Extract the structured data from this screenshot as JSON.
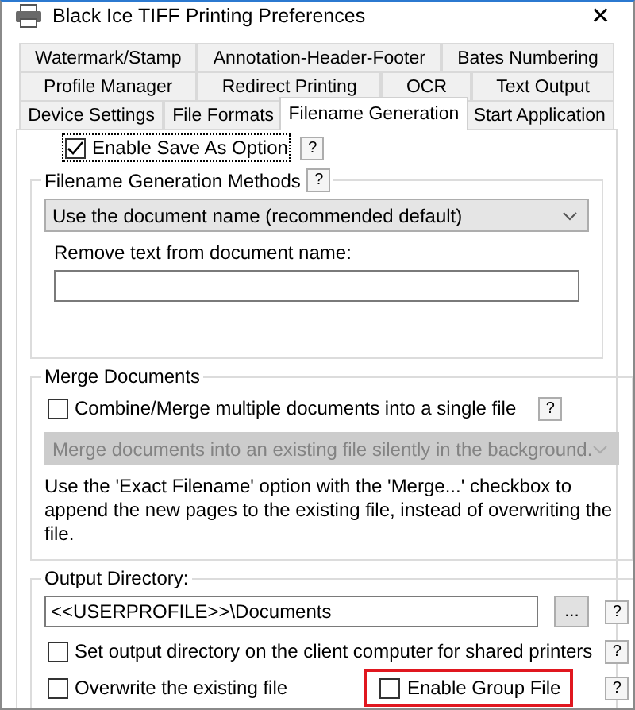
{
  "window": {
    "title": "Black Ice TIFF Printing Preferences",
    "close": "✕"
  },
  "tab_rows": [
    [
      {
        "label": "Watermark/Stamp",
        "selected": false
      },
      {
        "label": "Annotation-Header-Footer",
        "selected": false
      },
      {
        "label": "Bates Numbering",
        "selected": false
      }
    ],
    [
      {
        "label": "Profile Manager",
        "selected": false
      },
      {
        "label": "Redirect Printing",
        "selected": false
      },
      {
        "label": "OCR",
        "selected": false
      },
      {
        "label": "Text Output",
        "selected": false
      }
    ],
    [
      {
        "label": "Device Settings",
        "selected": false
      },
      {
        "label": "File Formats",
        "selected": false
      },
      {
        "label": "Filename Generation",
        "selected": true
      },
      {
        "label": "Start Application",
        "selected": false
      }
    ]
  ],
  "save_as": {
    "label": "Enable Save As Option",
    "checked": true,
    "help": "?"
  },
  "filename_methods": {
    "title": "Filename Generation Methods",
    "help": "?",
    "method": "Use the document name (recommended default)",
    "remove_label": "Remove text from document name:"
  },
  "merge": {
    "title": "Merge Documents",
    "checkbox": {
      "label": "Combine/Merge multiple documents into a single file",
      "checked": false
    },
    "help": "?",
    "mode": {
      "value": "Merge documents into an existing file silently in the background.",
      "disabled": true
    },
    "note": "Use the 'Exact Filename' option with the 'Merge...' checkbox to append the new pages to the existing file, instead of overwriting the file."
  },
  "output": {
    "title": "Output Directory:",
    "path": "<<USERPROFILE>>\\Documents",
    "browse": "...",
    "help": "?",
    "set_client": {
      "label": "Set output directory on the client computer for shared printers",
      "checked": false,
      "help": "?"
    },
    "overwrite": {
      "label": "Overwrite the existing file",
      "checked": false
    },
    "group_file": {
      "label": "Enable Group File",
      "checked": false,
      "highlighted": true,
      "help": "?"
    }
  }
}
